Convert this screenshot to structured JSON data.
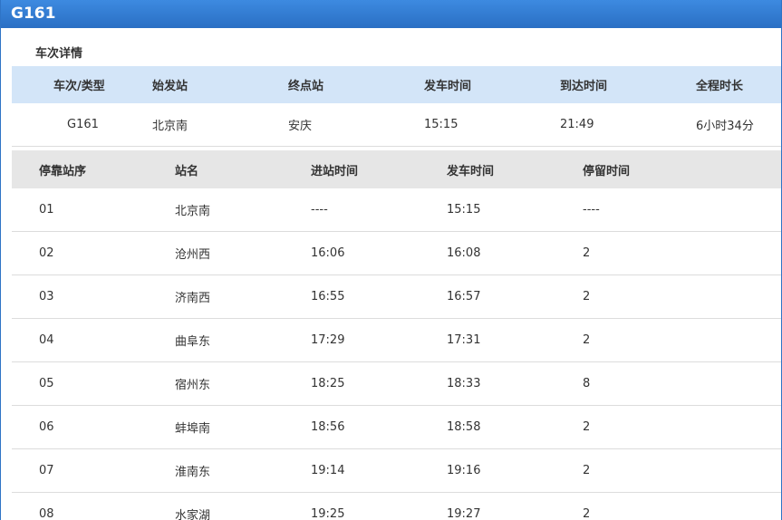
{
  "header": {
    "title": "G161"
  },
  "section": {
    "title": "车次详情"
  },
  "summary": {
    "columns": [
      "车次/类型",
      "始发站",
      "终点站",
      "发车时间",
      "到达时间",
      "全程时长"
    ],
    "values": [
      "G161",
      "北京南",
      "安庆",
      "15:15",
      "21:49",
      "6小时34分"
    ]
  },
  "stops": {
    "columns": [
      "停靠站序",
      "站名",
      "进站时间",
      "发车时间",
      "停留时间"
    ],
    "rows": [
      [
        "01",
        "北京南",
        "----",
        "15:15",
        "----"
      ],
      [
        "02",
        "沧州西",
        "16:06",
        "16:08",
        "2"
      ],
      [
        "03",
        "济南西",
        "16:55",
        "16:57",
        "2"
      ],
      [
        "04",
        "曲阜东",
        "17:29",
        "17:31",
        "2"
      ],
      [
        "05",
        "宿州东",
        "18:25",
        "18:33",
        "8"
      ],
      [
        "06",
        "蚌埠南",
        "18:56",
        "18:58",
        "2"
      ],
      [
        "07",
        "淮南东",
        "19:14",
        "19:16",
        "2"
      ],
      [
        "08",
        "水家湖",
        "19:25",
        "19:27",
        "2"
      ]
    ]
  }
}
